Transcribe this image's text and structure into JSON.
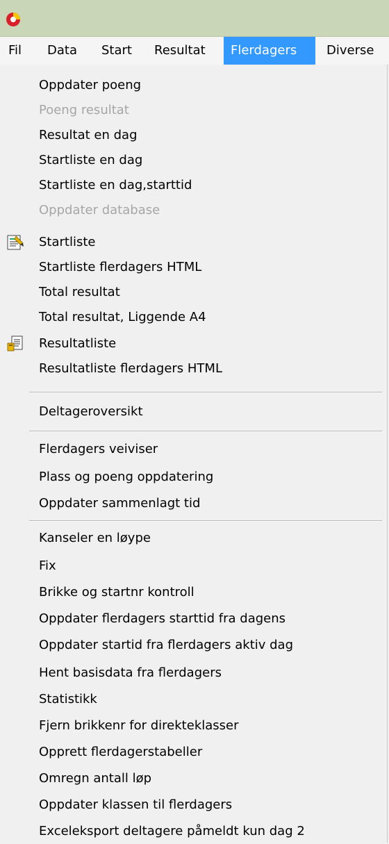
{
  "app": {
    "icon": "app-logo-icon"
  },
  "menubar": [
    {
      "label": "Fil",
      "active": false
    },
    {
      "label": "Data",
      "active": false
    },
    {
      "label": "Start",
      "active": false
    },
    {
      "label": "Resultat",
      "active": false
    },
    {
      "label": "Flerdagers",
      "active": true
    },
    {
      "label": "Diverse",
      "active": false
    }
  ],
  "dropdown": {
    "items": [
      {
        "label": "Oppdater poeng",
        "enabled": true
      },
      {
        "label": "Poeng resultat",
        "enabled": false
      },
      {
        "label": "Resultat en dag",
        "enabled": true
      },
      {
        "label": "Startliste en dag",
        "enabled": true
      },
      {
        "label": "Startliste en dag,starttid",
        "enabled": true
      },
      {
        "label": "Oppdater database",
        "enabled": false
      },
      {
        "label": "Startliste",
        "enabled": true,
        "icon": "startlist-icon"
      },
      {
        "label": "Startliste flerdagers HTML",
        "enabled": true
      },
      {
        "label": "Total resultat",
        "enabled": true
      },
      {
        "label": "Total resultat, Liggende A4",
        "enabled": true
      },
      {
        "label": "Resultatliste",
        "enabled": true,
        "icon": "result-list-icon"
      },
      {
        "label": "Resultatliste flerdagers HTML",
        "enabled": true
      },
      {
        "label": "Deltageroversikt",
        "enabled": true
      },
      {
        "label": "Flerdagers veiviser",
        "enabled": true
      },
      {
        "label": "Plass og poeng oppdatering",
        "enabled": true
      },
      {
        "label": "Oppdater sammenlagt tid",
        "enabled": true
      },
      {
        "label": "Kanseler en løype",
        "enabled": true
      },
      {
        "label": "Fix",
        "enabled": true
      },
      {
        "label": "Brikke og startnr kontroll",
        "enabled": true
      },
      {
        "label": "Oppdater flerdagers starttid fra dagens",
        "enabled": true
      },
      {
        "label": "Oppdater startid fra flerdagers aktiv dag",
        "enabled": true
      },
      {
        "label": "Hent basisdata fra flerdagers",
        "enabled": true
      },
      {
        "label": "Statistikk",
        "enabled": true
      },
      {
        "label": "Fjern brikkenr for direkteklasser",
        "enabled": true
      },
      {
        "label": "Opprett flerdagerstabeller",
        "enabled": true
      },
      {
        "label": "Omregn antall løp",
        "enabled": true
      },
      {
        "label": "Oppdater klassen til flerdagers",
        "enabled": true
      },
      {
        "label": "Exceleksport deltagere påmeldt kun dag 2",
        "enabled": true
      }
    ]
  },
  "colors": {
    "titlebar": "#c9d6b8",
    "highlight": "#3399ff",
    "disabled_text": "#a6a6a6",
    "menu_bg": "#f0f0f0"
  }
}
